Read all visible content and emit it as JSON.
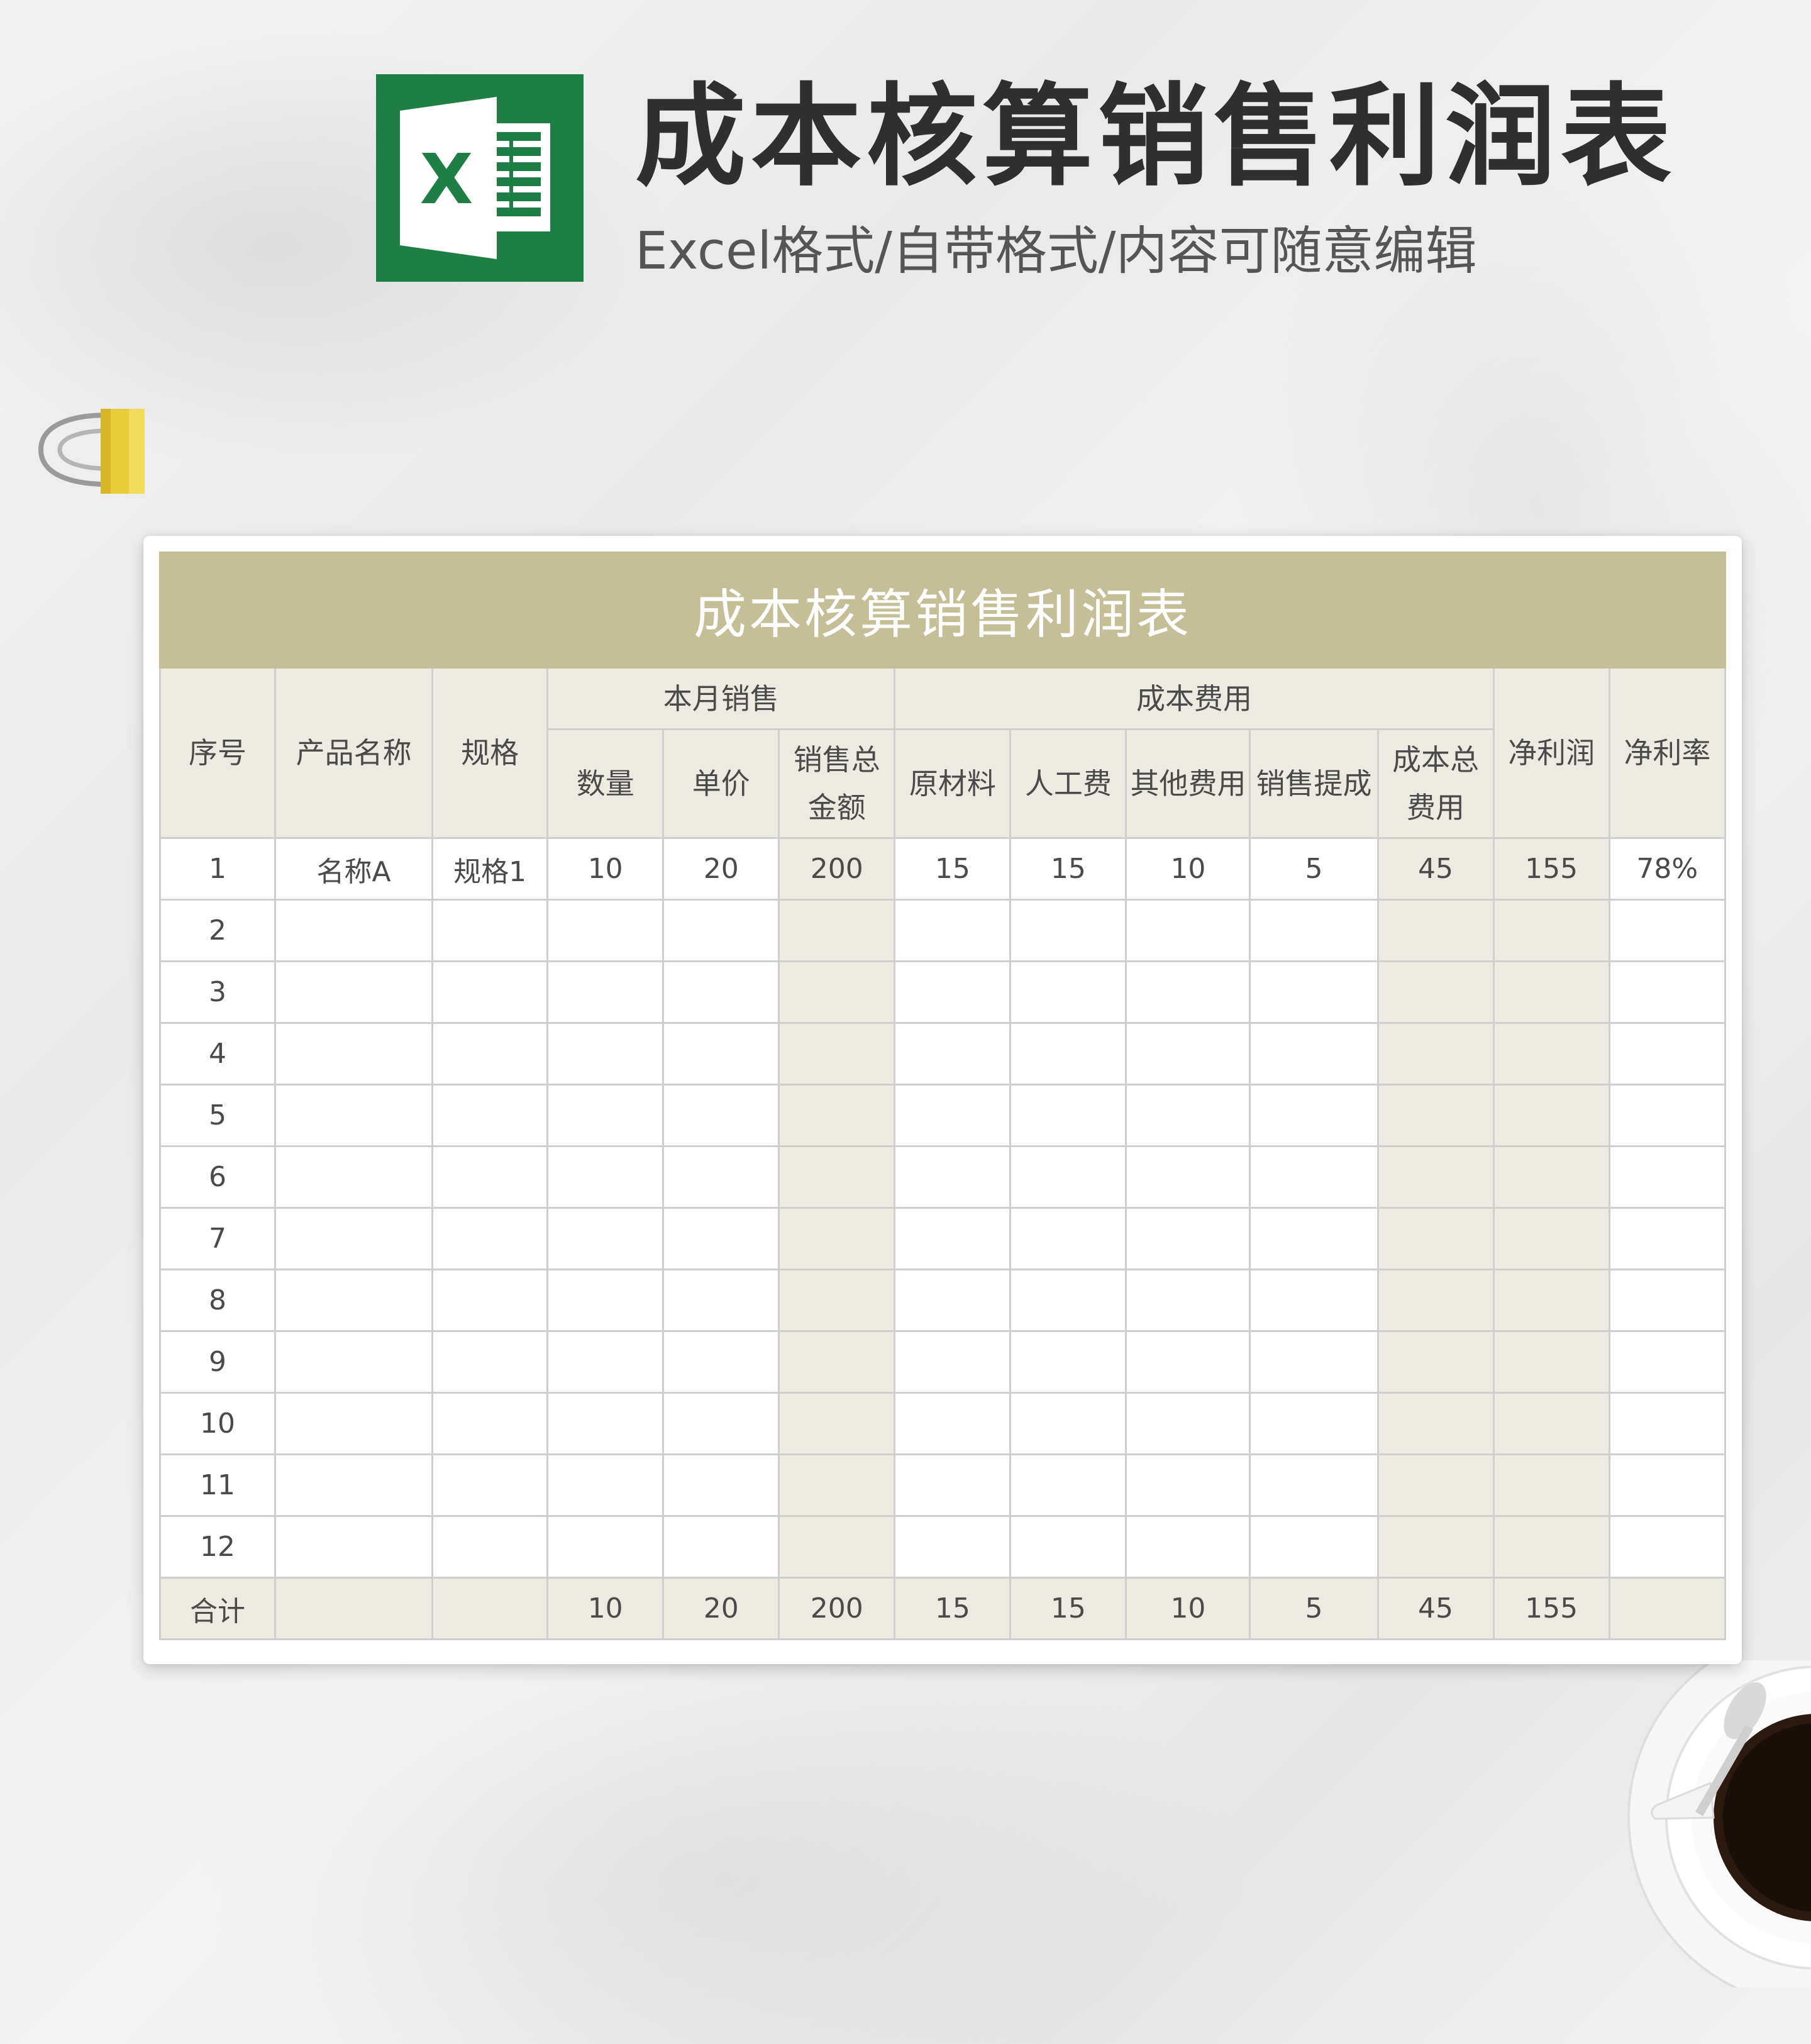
{
  "header": {
    "title": "成本核算销售利润表",
    "subtitle": "Excel格式/自带格式/内容可随意编辑",
    "logo_letter": "X",
    "logo_color": "#1e7e45"
  },
  "sheet": {
    "title": "成本核算销售利润表",
    "headers": {
      "seq": "序号",
      "product": "产品名称",
      "spec": "规格",
      "monthly_sales": "本月销售",
      "cost": "成本费用",
      "net_profit": "净利润",
      "net_rate": "净利率",
      "quantity": "数量",
      "unit_price": "单价",
      "sales_total_l1": "销售总",
      "sales_total_l2": "金额",
      "raw_material": "原材料",
      "labor": "人工费",
      "other": "其他费用",
      "commission": "销售提成",
      "cost_total_l1": "成本总",
      "cost_total_l2": "费用"
    },
    "rows": [
      {
        "seq": "1",
        "product": "名称A",
        "spec": "规格1",
        "qty": "10",
        "price": "20",
        "sales": "200",
        "raw": "15",
        "labor": "15",
        "other": "10",
        "commission": "5",
        "cost": "45",
        "profit": "155",
        "rate": "78%"
      },
      {
        "seq": "2",
        "product": "",
        "spec": "",
        "qty": "",
        "price": "",
        "sales": "",
        "raw": "",
        "labor": "",
        "other": "",
        "commission": "",
        "cost": "",
        "profit": "",
        "rate": ""
      },
      {
        "seq": "3",
        "product": "",
        "spec": "",
        "qty": "",
        "price": "",
        "sales": "",
        "raw": "",
        "labor": "",
        "other": "",
        "commission": "",
        "cost": "",
        "profit": "",
        "rate": ""
      },
      {
        "seq": "4",
        "product": "",
        "spec": "",
        "qty": "",
        "price": "",
        "sales": "",
        "raw": "",
        "labor": "",
        "other": "",
        "commission": "",
        "cost": "",
        "profit": "",
        "rate": ""
      },
      {
        "seq": "5",
        "product": "",
        "spec": "",
        "qty": "",
        "price": "",
        "sales": "",
        "raw": "",
        "labor": "",
        "other": "",
        "commission": "",
        "cost": "",
        "profit": "",
        "rate": ""
      },
      {
        "seq": "6",
        "product": "",
        "spec": "",
        "qty": "",
        "price": "",
        "sales": "",
        "raw": "",
        "labor": "",
        "other": "",
        "commission": "",
        "cost": "",
        "profit": "",
        "rate": ""
      },
      {
        "seq": "7",
        "product": "",
        "spec": "",
        "qty": "",
        "price": "",
        "sales": "",
        "raw": "",
        "labor": "",
        "other": "",
        "commission": "",
        "cost": "",
        "profit": "",
        "rate": ""
      },
      {
        "seq": "8",
        "product": "",
        "spec": "",
        "qty": "",
        "price": "",
        "sales": "",
        "raw": "",
        "labor": "",
        "other": "",
        "commission": "",
        "cost": "",
        "profit": "",
        "rate": ""
      },
      {
        "seq": "9",
        "product": "",
        "spec": "",
        "qty": "",
        "price": "",
        "sales": "",
        "raw": "",
        "labor": "",
        "other": "",
        "commission": "",
        "cost": "",
        "profit": "",
        "rate": ""
      },
      {
        "seq": "10",
        "product": "",
        "spec": "",
        "qty": "",
        "price": "",
        "sales": "",
        "raw": "",
        "labor": "",
        "other": "",
        "commission": "",
        "cost": "",
        "profit": "",
        "rate": ""
      },
      {
        "seq": "11",
        "product": "",
        "spec": "",
        "qty": "",
        "price": "",
        "sales": "",
        "raw": "",
        "labor": "",
        "other": "",
        "commission": "",
        "cost": "",
        "profit": "",
        "rate": ""
      },
      {
        "seq": "12",
        "product": "",
        "spec": "",
        "qty": "",
        "price": "",
        "sales": "",
        "raw": "",
        "labor": "",
        "other": "",
        "commission": "",
        "cost": "",
        "profit": "",
        "rate": ""
      }
    ],
    "total": {
      "label": "合计",
      "product": "",
      "spec": "",
      "qty": "10",
      "price": "20",
      "sales": "200",
      "raw": "15",
      "labor": "15",
      "other": "10",
      "commission": "5",
      "cost": "45",
      "profit": "155",
      "rate": ""
    },
    "colors": {
      "title_bg": "#c5bf98",
      "header_bg": "#edebe1",
      "border": "#cfcfcf"
    }
  }
}
